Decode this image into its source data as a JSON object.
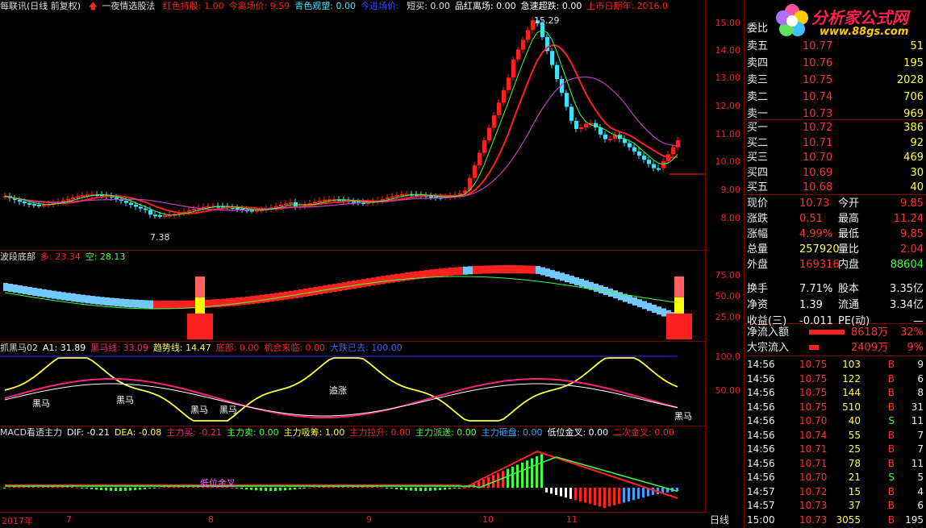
{
  "main_header": {
    "title": "每联讯(日线 前复权)",
    "indicator": "一夜情选股法",
    "items": [
      {
        "label": "红色持股:",
        "value": "1.00",
        "color": "#ff2020"
      },
      {
        "label": "今离场价:",
        "value": "9.59",
        "color": "#ff2020"
      },
      {
        "label": "青色观望:",
        "value": "0.00",
        "color": "#40e0ff"
      },
      {
        "label": "今进场价:",
        "value": "",
        "color": "#4040ff"
      },
      {
        "label": "短买:",
        "value": "0.00",
        "color": "#dddddd"
      },
      {
        "label": "品红离场:",
        "value": "0.00",
        "color": "#ffffff"
      },
      {
        "label": "急速超跌:",
        "value": "0.00",
        "color": "#ffffff"
      },
      {
        "label": "上市日期年:",
        "value": "2016.0",
        "color": "#ff2020"
      }
    ],
    "price_axis": [
      "15.00",
      "14.00",
      "13.00",
      "12.00",
      "11.00",
      "10.00",
      "9.00",
      "8.00"
    ],
    "annotations": {
      "high": "15.29",
      "low": "7.38"
    }
  },
  "panel2": {
    "title": "波段底部",
    "items": [
      {
        "label": "多:",
        "value": "23.34",
        "color": "#ff2020"
      },
      {
        "label": "空:",
        "value": "28.13",
        "color": "#40ff40"
      }
    ],
    "axis": [
      "75.00",
      "50.00",
      "25.00"
    ]
  },
  "panel3": {
    "title": "抓黑马02",
    "items": [
      {
        "label": "A1:",
        "value": "31.89",
        "color": "#ffffff"
      },
      {
        "label": "黑马线:",
        "value": "33.09",
        "color": "#ff2080"
      },
      {
        "label": "趋势线:",
        "value": "14.47",
        "color": "#ffff40"
      },
      {
        "label": "底部:",
        "value": "0.00",
        "color": "#ff2020"
      },
      {
        "label": "机会来临:",
        "value": "0.00",
        "color": "#ff2020"
      },
      {
        "label": "大跌已去:",
        "value": "100.00",
        "color": "#4060ff"
      }
    ],
    "axis": [
      "100.0",
      "50.00"
    ],
    "labels": [
      "黑马",
      "黑马",
      "黑马",
      "黑马",
      "追涨",
      "黑马"
    ]
  },
  "panel4": {
    "title": "MACD看透主力",
    "items": [
      {
        "label": "DIF:",
        "value": "-0.21",
        "color": "#ffffff"
      },
      {
        "label": "DEA:",
        "value": "-0.08",
        "color": "#ffff40"
      },
      {
        "label": "主力买:",
        "value": "-0.21",
        "color": "#ff2080"
      },
      {
        "label": "主力卖:",
        "value": "0.00",
        "color": "#40ff40"
      },
      {
        "label": "主力吸筹:",
        "value": "1.00",
        "color": "#ffff40"
      },
      {
        "label": "主力拉升:",
        "value": "0.00",
        "color": "#ff2020"
      },
      {
        "label": "主力派送:",
        "value": "0.00",
        "color": "#40ff40"
      },
      {
        "label": "主力砸盘:",
        "value": "0.00",
        "color": "#40a0ff"
      },
      {
        "label": "低位金叉:",
        "value": "0.00",
        "color": "#ffffff"
      },
      {
        "label": "二次金叉:",
        "value": "0.00",
        "color": "#ff2020"
      }
    ],
    "note": "低位金叉"
  },
  "time_axis": {
    "labels": [
      "2017年",
      "7",
      "8",
      "9",
      "10",
      "11"
    ],
    "period": "日线"
  },
  "logo": {
    "text": "分析家公式网",
    "url": "www.88gs.com"
  },
  "orderbook": {
    "header": "委比",
    "sell": [
      {
        "label": "卖五",
        "price": "10.77",
        "vol": "51"
      },
      {
        "label": "卖四",
        "price": "10.76",
        "vol": "195"
      },
      {
        "label": "卖三",
        "price": "10.75",
        "vol": "2028"
      },
      {
        "label": "卖二",
        "price": "10.74",
        "vol": "706"
      },
      {
        "label": "卖一",
        "price": "10.73",
        "vol": "969"
      }
    ],
    "buy": [
      {
        "label": "买一",
        "price": "10.72",
        "vol": "386"
      },
      {
        "label": "买二",
        "price": "10.71",
        "vol": "92"
      },
      {
        "label": "买三",
        "price": "10.70",
        "vol": "469"
      },
      {
        "label": "买四",
        "price": "10.69",
        "vol": "30"
      },
      {
        "label": "买五",
        "price": "10.68",
        "vol": "40"
      }
    ]
  },
  "stats": [
    [
      {
        "l": "现价",
        "v": "10.73",
        "c": "#ff3030"
      },
      {
        "l": "今开",
        "v": "9.85",
        "c": "#ff3030"
      }
    ],
    [
      {
        "l": "涨跌",
        "v": "0.51",
        "c": "#ff3030"
      },
      {
        "l": "最高",
        "v": "11.24",
        "c": "#ff3030"
      }
    ],
    [
      {
        "l": "涨幅",
        "v": "4.99%",
        "c": "#ff3030"
      },
      {
        "l": "最低",
        "v": "9.85",
        "c": "#ff3030"
      }
    ],
    [
      {
        "l": "总量",
        "v": "257920",
        "c": "#ffff40"
      },
      {
        "l": "量比",
        "v": "2.04",
        "c": "#ff3030"
      }
    ],
    [
      {
        "l": "外盘",
        "v": "169316",
        "c": "#ff3030"
      },
      {
        "l": "内盘",
        "v": "88604",
        "c": "#40ff40"
      }
    ],
    [
      {
        "l": "换手",
        "v": "7.71%",
        "c": "#eeeeee"
      },
      {
        "l": "股本",
        "v": "3.35亿",
        "c": "#eeeeee"
      }
    ],
    [
      {
        "l": "净资",
        "v": "1.39",
        "c": "#eeeeee"
      },
      {
        "l": "流通",
        "v": "3.34亿",
        "c": "#eeeeee"
      }
    ],
    [
      {
        "l": "收益(三)",
        "v": "-0.011",
        "c": "#eeeeee"
      },
      {
        "l": "PE(动)",
        "v": "—",
        "c": "#eeeeee"
      }
    ]
  ],
  "flow": [
    {
      "label": "净流入额",
      "value": "8618万",
      "pct": "32%"
    },
    {
      "label": "大宗流入",
      "value": "2409万",
      "pct": "9%"
    }
  ],
  "ticks": [
    {
      "t": "14:56",
      "p": "10.75",
      "v": "103",
      "d": "B",
      "n": "9"
    },
    {
      "t": "14:56",
      "p": "10.75",
      "v": "122",
      "d": "B",
      "n": "6"
    },
    {
      "t": "14:56",
      "p": "10.75",
      "v": "144",
      "d": "B",
      "n": "8"
    },
    {
      "t": "14:56",
      "p": "10.75",
      "v": "510",
      "d": "B",
      "n": "31"
    },
    {
      "t": "14:56",
      "p": "10.70",
      "v": "40",
      "d": "S",
      "n": "11"
    },
    {
      "t": "14:56",
      "p": "10.74",
      "v": "55",
      "d": "B",
      "n": "7"
    },
    {
      "t": "14:56",
      "p": "10.71",
      "v": "25",
      "d": "B",
      "n": "7"
    },
    {
      "t": "14:56",
      "p": "10.71",
      "v": "78",
      "d": "B",
      "n": "11"
    },
    {
      "t": "14:56",
      "p": "10.70",
      "v": "21",
      "d": "S",
      "n": "5"
    },
    {
      "t": "14:57",
      "p": "10.72",
      "v": "15",
      "d": "B",
      "n": "4"
    },
    {
      "t": "14:57",
      "p": "10.73",
      "v": "37",
      "d": "B",
      "n": "6"
    },
    {
      "t": "15:00",
      "p": "10.73",
      "v": "3055",
      "d": "B",
      "n": "195"
    }
  ],
  "colors": {
    "up": "#ff2020",
    "down": "#40e0ff",
    "border": "#7a0000"
  }
}
